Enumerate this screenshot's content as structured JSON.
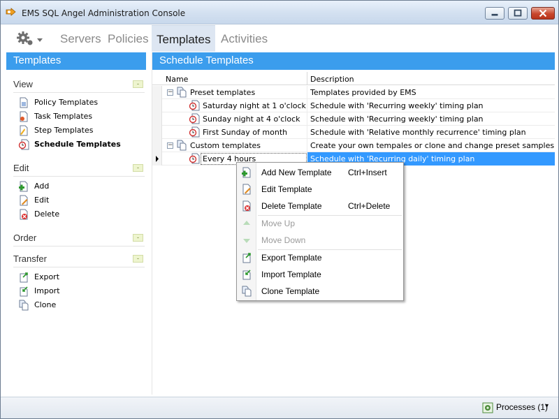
{
  "window": {
    "title": "EMS SQL Angel Administration Console"
  },
  "nav": {
    "tabs": [
      {
        "label": "Servers"
      },
      {
        "label": "Policies"
      },
      {
        "label": "Templates"
      },
      {
        "label": "Activities"
      }
    ],
    "active_tab": "Templates"
  },
  "left_panel": {
    "title": "Templates",
    "collapse_glyph": "-",
    "sections": {
      "view": {
        "title": "View",
        "items": [
          {
            "label": "Policy Templates",
            "icon": "policy-templates-icon"
          },
          {
            "label": "Task Templates",
            "icon": "task-templates-icon"
          },
          {
            "label": "Step Templates",
            "icon": "step-templates-icon"
          },
          {
            "label": "Schedule Templates",
            "icon": "schedule-templates-icon"
          }
        ]
      },
      "edit": {
        "title": "Edit",
        "items": [
          {
            "label": "Add",
            "icon": "add-icon"
          },
          {
            "label": "Edit",
            "icon": "edit-icon"
          },
          {
            "label": "Delete",
            "icon": "delete-icon"
          }
        ]
      },
      "order": {
        "title": "Order"
      },
      "transfer": {
        "title": "Transfer",
        "items": [
          {
            "label": "Export",
            "icon": "export-icon"
          },
          {
            "label": "Import",
            "icon": "import-icon"
          },
          {
            "label": "Clone",
            "icon": "clone-icon"
          }
        ]
      }
    }
  },
  "main": {
    "title": "Schedule Templates",
    "columns": {
      "name": "Name",
      "description": "Description"
    },
    "rows": [
      {
        "name": "Preset templates",
        "description": "Templates provided by EMS",
        "expander": "−"
      },
      {
        "name": "Saturday night at 1 o'clock",
        "description": "Schedule with 'Recurring weekly' timing plan"
      },
      {
        "name": "Sunday night at 4 o'clock",
        "description": "Schedule with 'Recurring weekly' timing plan"
      },
      {
        "name": "First Sunday of month",
        "description": "Schedule with 'Relative monthly recurrence' timing plan"
      },
      {
        "name": "Custom templates",
        "description": "Create your own tempales or clone and change preset samples",
        "expander": "−"
      },
      {
        "name": "Every 4 hours",
        "description": "Schedule with 'Recurring daily' timing plan",
        "selected": true
      }
    ]
  },
  "context_menu": {
    "items": [
      {
        "label": "Add New Template",
        "shortcut": "Ctrl+Insert",
        "icon": "add-template-icon"
      },
      {
        "label": "Edit Template",
        "icon": "edit-template-icon"
      },
      {
        "label": "Delete Template",
        "shortcut": "Ctrl+Delete",
        "icon": "delete-template-icon"
      },
      {
        "label": "Move Up",
        "icon": "move-up-icon",
        "disabled": true
      },
      {
        "label": "Move Down",
        "icon": "move-down-icon",
        "disabled": true
      },
      {
        "label": "Export Template",
        "icon": "export-template-icon"
      },
      {
        "label": "Import Template",
        "icon": "import-template-icon"
      },
      {
        "label": "Clone Template",
        "icon": "clone-template-icon"
      }
    ]
  },
  "status": {
    "processes": "Processes (1)",
    "dropdown_glyph": "▾"
  },
  "colors": {
    "accent": "#3b9ded",
    "selection": "#3399ff",
    "active_tab_bg": "#dde6f2"
  }
}
